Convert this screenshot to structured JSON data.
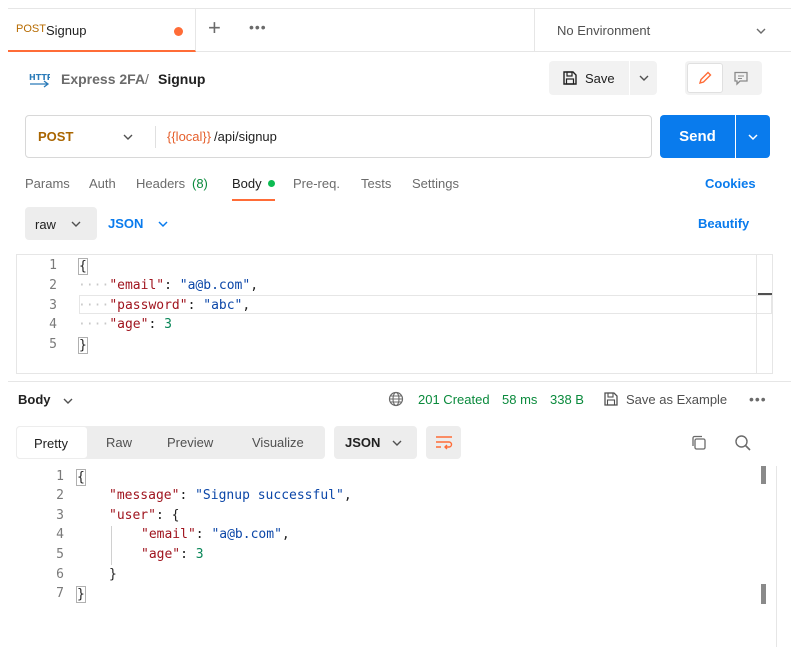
{
  "tab": {
    "method": "POST",
    "name": "Signup"
  },
  "environment": {
    "label": "No Environment"
  },
  "breadcrumb": {
    "collection": "Express 2FA",
    "separator": "/",
    "request": "Signup"
  },
  "toolbar": {
    "save_label": "Save"
  },
  "request": {
    "method": "POST",
    "url_var": "{{local}}",
    "url_path": "/api/signup",
    "send_label": "Send"
  },
  "request_tabs": {
    "params": "Params",
    "auth": "Auth",
    "headers": "Headers",
    "headers_count": "(8)",
    "body": "Body",
    "prereq": "Pre-req.",
    "tests": "Tests",
    "settings": "Settings",
    "cookies": "Cookies"
  },
  "body_mode": {
    "type": "raw",
    "language": "JSON",
    "beautify": "Beautify"
  },
  "request_body": {
    "lines": [
      "1",
      "2",
      "3",
      "4",
      "5"
    ],
    "open_brace": "{",
    "close_brace": "}",
    "email_key": "\"email\"",
    "email_val": "\"a@b.com\"",
    "password_key": "\"password\"",
    "password_val": "\"abc\"",
    "age_key": "\"age\"",
    "age_val": "3"
  },
  "response": {
    "label": "Body",
    "status": "201 Created",
    "time": "58 ms",
    "size": "338 B",
    "save_example": "Save as Example",
    "views": [
      "Pretty",
      "Raw",
      "Preview",
      "Visualize"
    ],
    "language": "JSON",
    "lines": [
      "1",
      "2",
      "3",
      "4",
      "5",
      "6",
      "7"
    ],
    "open_brace": "{",
    "close_brace": "}",
    "message_key": "\"message\"",
    "message_val": "\"Signup successful\"",
    "user_key": "\"user\"",
    "email_key": "\"email\"",
    "email_val": "\"a@b.com\"",
    "age_key": "\"age\"",
    "age_val": "3"
  },
  "colors": {
    "accent": "#ff6c37",
    "send_blue": "#097bed",
    "status_green": "#0a8a3c"
  }
}
